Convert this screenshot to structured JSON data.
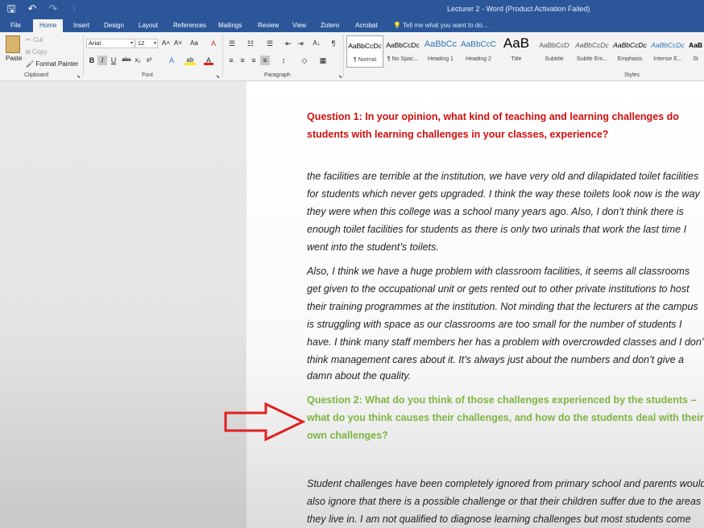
{
  "window": {
    "title": "Lecturer 2 - Word (Product Activation Failed)"
  },
  "qat": [
    {
      "name": "save-icon",
      "glyph": "🖫"
    },
    {
      "name": "undo-icon",
      "glyph": "↶"
    },
    {
      "name": "redo-icon",
      "glyph": "↷"
    },
    {
      "name": "customize-qat-icon",
      "glyph": "⫶"
    }
  ],
  "tabs": [
    "File",
    "Home",
    "Insert",
    "Design",
    "Layout",
    "References",
    "Mailings",
    "Review",
    "View",
    "Zotero",
    "Acrobat"
  ],
  "tell_me": "Tell me what you want to do...",
  "clipboard": {
    "paste": "Paste",
    "cut": "Cut",
    "copy": "Copy",
    "format_painter": "Format Painter",
    "group": "Clipboard"
  },
  "font": {
    "name": "Arial",
    "size": "12",
    "grow": "A˄",
    "shrink": "A˅",
    "case": "Aa",
    "clear": "A",
    "bold": "B",
    "italic": "I",
    "underline": "U",
    "strike": "abc",
    "sub": "x₂",
    "sup": "x²",
    "effects": "A",
    "highlight": "ab",
    "color": "A",
    "group": "Font"
  },
  "paragraph": {
    "bullets": "☰",
    "numbering": "☷",
    "multilevel": "☰",
    "decrease_indent": "⇤",
    "increase_indent": "⇥",
    "sort": "A↓",
    "pilcrow": "¶",
    "align_left": "≡",
    "center": "≡",
    "align_right": "≡",
    "justify": "≡",
    "line_spacing": "↕",
    "shading": "◇",
    "borders": "▦",
    "group": "Paragraph"
  },
  "styles": {
    "group": "Styles",
    "items": [
      {
        "sample": "AaBbCcDc",
        "name": "¶ Normal"
      },
      {
        "sample": "AaBbCcDc",
        "name": "¶ No Spac..."
      },
      {
        "sample": "AaBbCc",
        "name": "Heading 1"
      },
      {
        "sample": "AaBbCcC",
        "name": "Heading 2"
      },
      {
        "sample": "AaB",
        "name": "Title"
      },
      {
        "sample": "AaBbCcD",
        "name": "Subtitle"
      },
      {
        "sample": "AaBbCcDc",
        "name": "Subtle Em..."
      },
      {
        "sample": "AaBbCcDc",
        "name": "Emphasis"
      },
      {
        "sample": "AaBbCcDc",
        "name": "Intense E..."
      },
      {
        "sample": "AaB",
        "name": "St"
      }
    ]
  },
  "document": {
    "q1_lines": [
      "Question 1: In your opinion, what kind of teaching and learning challenges do",
      "students with learning challenges in your classes, experience?"
    ],
    "p1_lines": [
      "the facilities are terrible at the institution, we have very old and dilapidated toilet facilities",
      "for students which never gets upgraded. I think the way these toilets look now is the way",
      "they were when this college was a school many years ago. Also, I don’t think there is",
      "enough toilet facilities for students as there is only two urinals that work the last time I",
      "went into the student’s toilets."
    ],
    "p2_lines": [
      "Also, I think we have a huge problem with classroom facilities, it seems all classrooms",
      "get given to the occupational unit or gets rented out to other private institutions to host",
      "their training programmes at the institution. Not minding that the lecturers at the campus",
      "is struggling with space as our classrooms are too small for the number of students I",
      "have. I think many staff members her has a problem with overcrowded classes and I don’t",
      "think management cares about it. It’s always just about the numbers and don’t give a",
      "damn about the quality."
    ],
    "q2_lines": [
      "Question 2:  What do you think of those challenges experienced by the students –",
      "what do you think causes their challenges, and how do the students deal with their",
      "own challenges?"
    ],
    "p3_lines": [
      "Student challenges have been completely ignored from primary school and parents would",
      "also ignore that there is a possible challenge or that their children suffer due to the areas",
      "they live in. I am not qualified to diagnose learning challenges but most students come"
    ]
  },
  "colors": {
    "brand": "#2b579a",
    "question1": "#d10f0f",
    "question2": "#7db543",
    "arrow": "#e02020"
  }
}
